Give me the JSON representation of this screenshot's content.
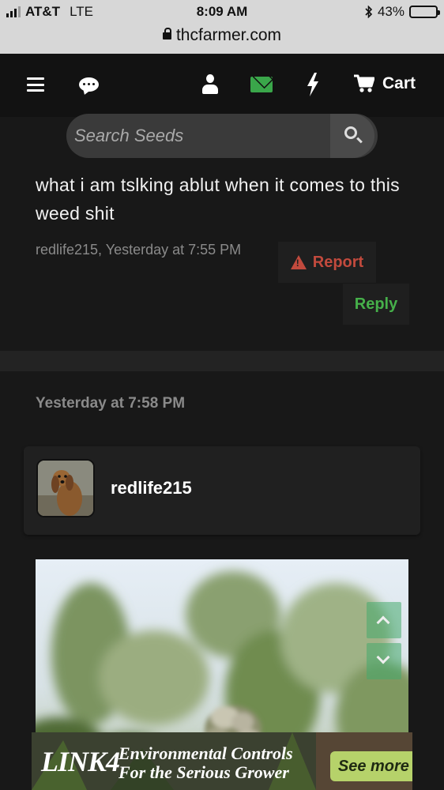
{
  "status_bar": {
    "carrier": "AT&T",
    "network": "LTE",
    "time": "8:09 AM",
    "battery": "43%",
    "battery_level": 0.43
  },
  "browser": {
    "url": "thcfarmer.com"
  },
  "nav": {
    "cart_label": "Cart",
    "icons": [
      "menu-icon",
      "chat-icon",
      "user-icon",
      "mail-icon",
      "bolt-icon",
      "cart-icon"
    ],
    "mail_color": "#3aa64a"
  },
  "search": {
    "placeholder": "Search Seeds"
  },
  "post": {
    "message": "what i am tslking ablut when it comes to this weed shit",
    "author": "redlife215",
    "timestamp": "Yesterday at 7:55 PM",
    "meta": "redlife215, Yesterday at 7:55 PM",
    "report_label": "Report",
    "reply_label": "Reply",
    "report_color": "#c24a3d",
    "reply_color": "#46b04a"
  },
  "next_post": {
    "date": "Yesterday at 7:58 PM",
    "username": "redlife215"
  },
  "ad": {
    "brand": "LINK4",
    "headline_1": "Environmental Controls",
    "headline_2": "For the Serious Grower",
    "cta": "See more ›"
  }
}
